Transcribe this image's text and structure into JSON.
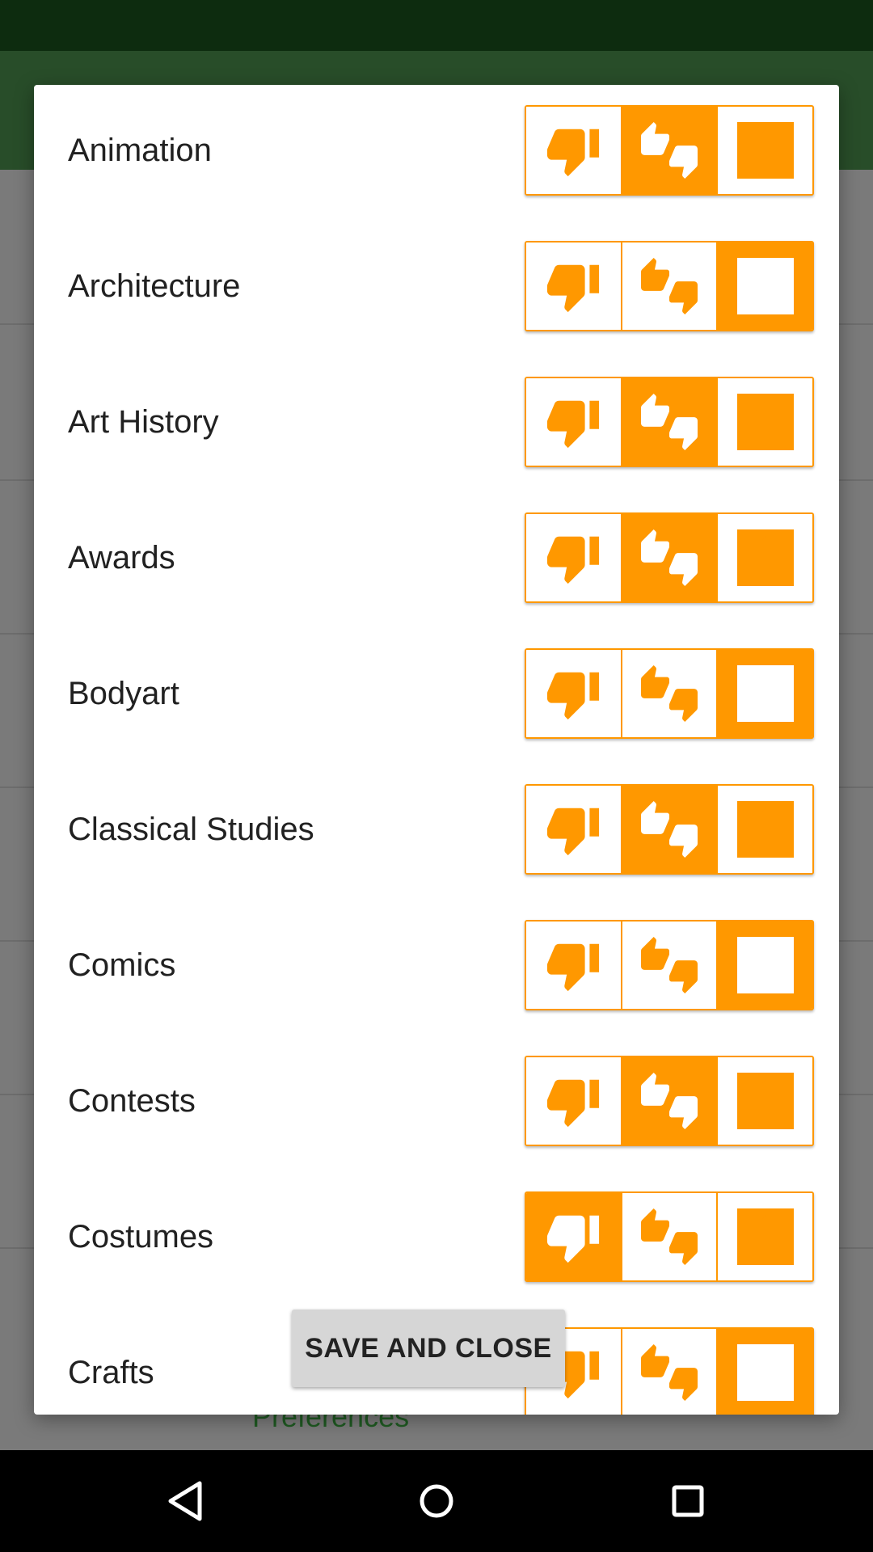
{
  "dialog": {
    "categories": [
      {
        "label": "Animation",
        "selected": "neutral"
      },
      {
        "label": "Architecture",
        "selected": "like"
      },
      {
        "label": "Art History",
        "selected": "neutral"
      },
      {
        "label": "Awards",
        "selected": "neutral"
      },
      {
        "label": "Bodyart",
        "selected": "like"
      },
      {
        "label": "Classical Studies",
        "selected": "neutral"
      },
      {
        "label": "Comics",
        "selected": "like"
      },
      {
        "label": "Contests",
        "selected": "neutral"
      },
      {
        "label": "Costumes",
        "selected": "dislike"
      },
      {
        "label": "Crafts",
        "selected": "like"
      }
    ],
    "options": [
      "dislike",
      "neutral",
      "like"
    ],
    "icons": {
      "dislike": "thumbs-down-icon",
      "neutral": "thumbs-up-down-icon",
      "like": "thumbs-up-icon"
    },
    "save_label": "SAVE AND CLOSE"
  },
  "background": {
    "link_label": "Preferences"
  },
  "colors": {
    "accent": "#ff9800",
    "status_bar": "#0d2c0f",
    "app_bar": "#284d29"
  },
  "nav": {
    "back_icon": "back-triangle-icon",
    "home_icon": "home-circle-icon",
    "recent_icon": "recents-square-icon"
  }
}
